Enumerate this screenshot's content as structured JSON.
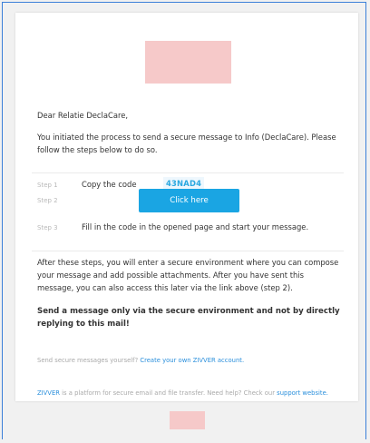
{
  "email": {
    "greeting": "Dear Relatie DeclaCare,",
    "intro": "You initiated the process to send a secure message to Info (DeclaCare). Please follow the steps below to do so.",
    "steps": [
      {
        "label": "Step 1",
        "text": "Copy the code",
        "code": "43NAD4"
      },
      {
        "label": "Step 2",
        "button_label": "Click here"
      },
      {
        "label": "Step 3",
        "text": "Fill in the code in the opened page and start your message."
      }
    ],
    "after_text": "After these steps, you will enter a secure environment where you can compose your message and add possible attachments. After you have sent this message, you can also access this later via the link above (step 2).",
    "warning": "Send a message only via the secure environment and not by directly replying to this mail!",
    "self_send": {
      "prefix": "Send secure messages yourself?",
      "link": "Create your own ZIVVER account."
    },
    "footer": {
      "brand": "ZIVVER",
      "text": "is a platform for secure email and file transfer. Need help? Check our",
      "link": "support website."
    }
  },
  "colors": {
    "accent": "#1aa5e3",
    "link": "#2a8fdc",
    "code_text": "#2aa8e0",
    "logo_placeholder": "#f6c9c9",
    "frame_border": "#3b7fd9"
  }
}
